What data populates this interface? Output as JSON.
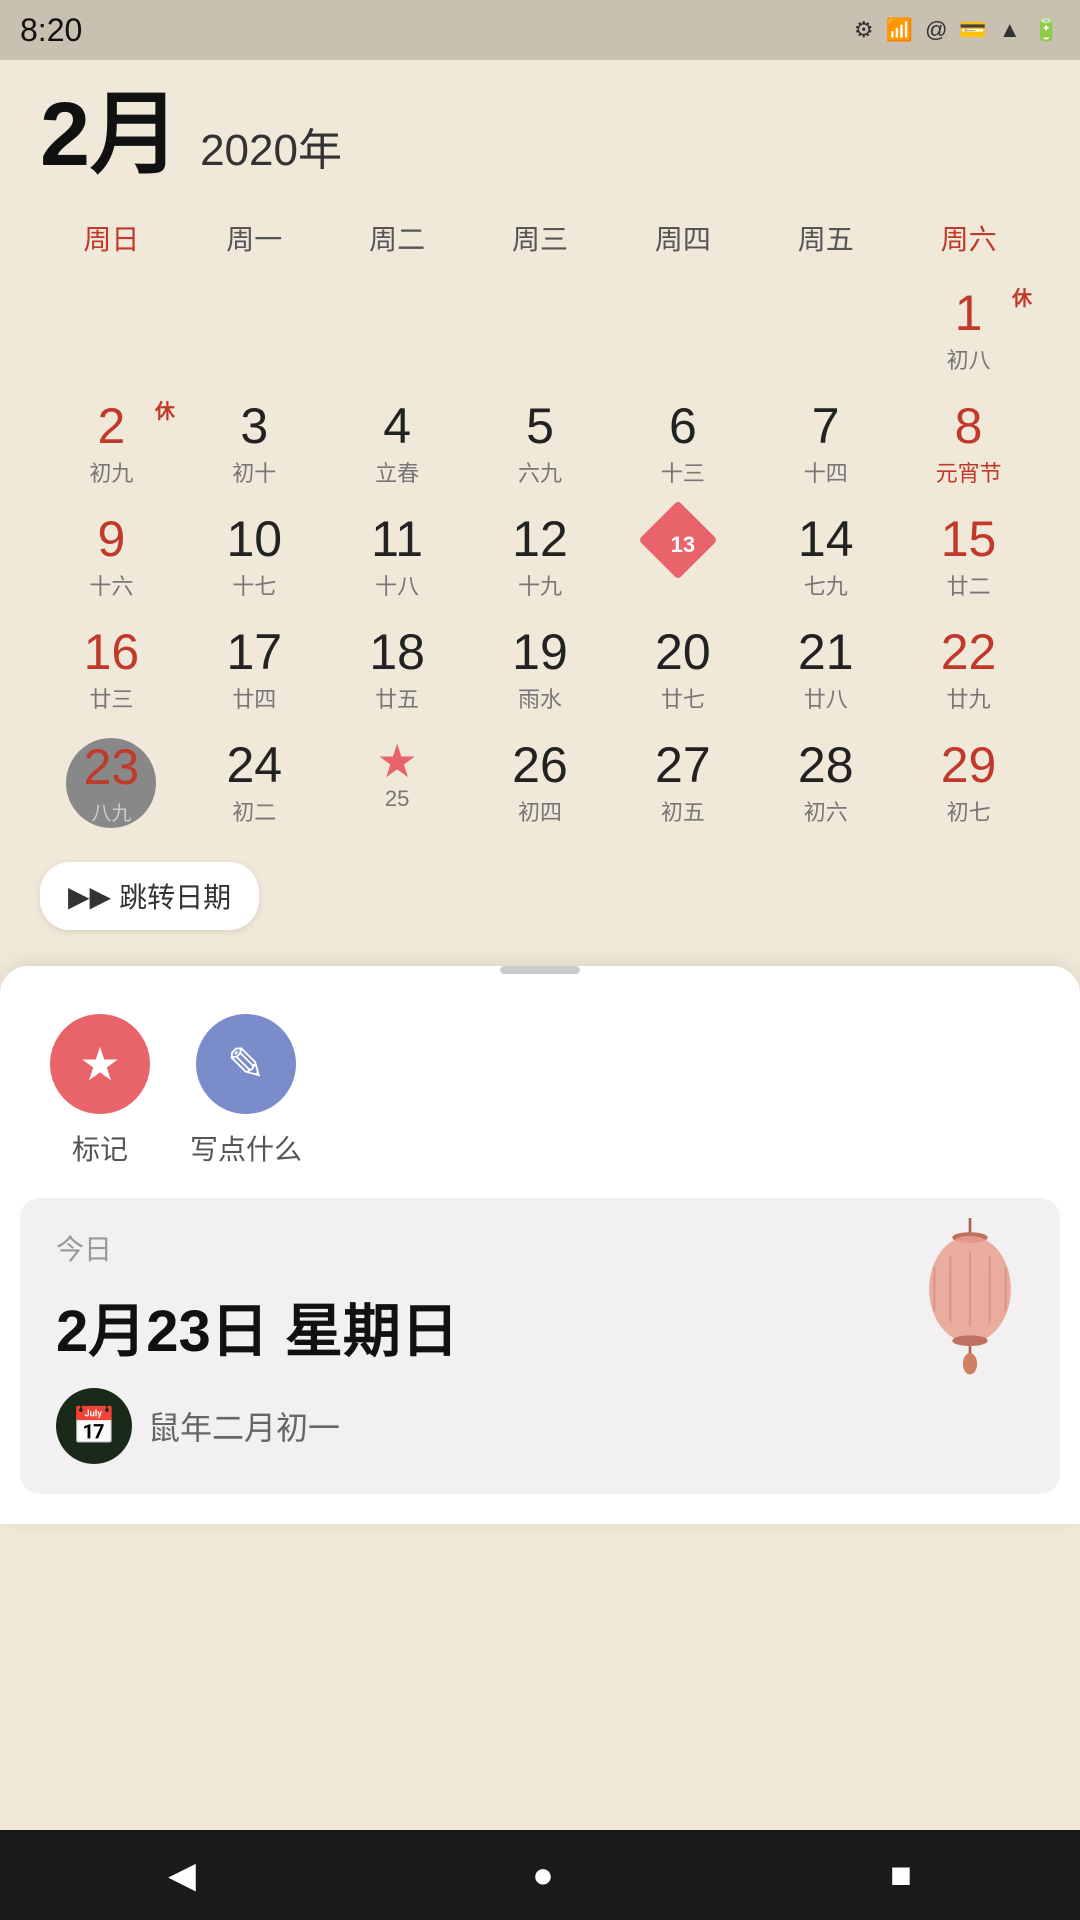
{
  "statusBar": {
    "time": "8:20",
    "icons": [
      "settings",
      "wifi-question",
      "at-sign",
      "sim-card"
    ]
  },
  "calendar": {
    "monthCn": "2月",
    "yearCn": "2020年",
    "weekdays": [
      {
        "label": "周日",
        "isRed": true
      },
      {
        "label": "周一",
        "isRed": false
      },
      {
        "label": "周二",
        "isRed": false
      },
      {
        "label": "周三",
        "isRed": false
      },
      {
        "label": "周四",
        "isRed": false
      },
      {
        "label": "周五",
        "isRed": false
      },
      {
        "label": "周六",
        "isRed": true
      }
    ],
    "days": [
      {
        "num": "",
        "lunar": "",
        "type": "empty"
      },
      {
        "num": "",
        "lunar": "",
        "type": "empty"
      },
      {
        "num": "",
        "lunar": "",
        "type": "empty"
      },
      {
        "num": "",
        "lunar": "",
        "type": "empty"
      },
      {
        "num": "",
        "lunar": "",
        "type": "empty"
      },
      {
        "num": "",
        "lunar": "",
        "type": "empty"
      },
      {
        "num": "1",
        "lunar": "初八",
        "type": "sat",
        "holiday": "休"
      },
      {
        "num": "2",
        "lunar": "初九",
        "type": "sun-holiday",
        "holiday": "休"
      },
      {
        "num": "3",
        "lunar": "初十",
        "type": "normal"
      },
      {
        "num": "4",
        "lunar": "立春",
        "type": "solar-term"
      },
      {
        "num": "5",
        "lunar": "六九",
        "type": "normal"
      },
      {
        "num": "6",
        "lunar": "十三",
        "type": "normal"
      },
      {
        "num": "7",
        "lunar": "十四",
        "type": "normal"
      },
      {
        "num": "8",
        "lunar": "元宵节",
        "type": "sat"
      },
      {
        "num": "9",
        "lunar": "十六",
        "type": "sun"
      },
      {
        "num": "10",
        "lunar": "十七",
        "type": "normal"
      },
      {
        "num": "11",
        "lunar": "十八",
        "type": "normal"
      },
      {
        "num": "12",
        "lunar": "十九",
        "type": "normal"
      },
      {
        "num": "13",
        "lunar": "13",
        "type": "diamond"
      },
      {
        "num": "14",
        "lunar": "七九",
        "type": "normal"
      },
      {
        "num": "15",
        "lunar": "廿二",
        "type": "sat"
      },
      {
        "num": "16",
        "lunar": "廿三",
        "type": "sun"
      },
      {
        "num": "17",
        "lunar": "廿四",
        "type": "normal"
      },
      {
        "num": "18",
        "lunar": "廿五",
        "type": "normal"
      },
      {
        "num": "19",
        "lunar": "雨水",
        "type": "solar-term"
      },
      {
        "num": "20",
        "lunar": "廿七",
        "type": "normal"
      },
      {
        "num": "21",
        "lunar": "廿八",
        "type": "normal"
      },
      {
        "num": "22",
        "lunar": "廿九",
        "type": "sat"
      },
      {
        "num": "23",
        "lunar": "八九",
        "type": "today"
      },
      {
        "num": "24",
        "lunar": "初二",
        "type": "normal"
      },
      {
        "num": "25",
        "lunar": "25",
        "type": "star"
      },
      {
        "num": "26",
        "lunar": "初四",
        "type": "normal"
      },
      {
        "num": "27",
        "lunar": "初五",
        "type": "normal"
      },
      {
        "num": "28",
        "lunar": "初六",
        "type": "normal"
      },
      {
        "num": "29",
        "lunar": "初七",
        "type": "sat"
      }
    ]
  },
  "jumpDateBtn": "跳转日期",
  "bottomSheet": {
    "actions": [
      {
        "label": "标记",
        "icon": "★",
        "color": "red"
      },
      {
        "label": "写点什么",
        "icon": "✎",
        "color": "blue"
      }
    ]
  },
  "todayCard": {
    "label": "今日",
    "dateText": "2月23日 星期日",
    "lunarText": "鼠年二月初一"
  },
  "navBar": {
    "back": "◀",
    "home": "●",
    "recent": "■"
  }
}
